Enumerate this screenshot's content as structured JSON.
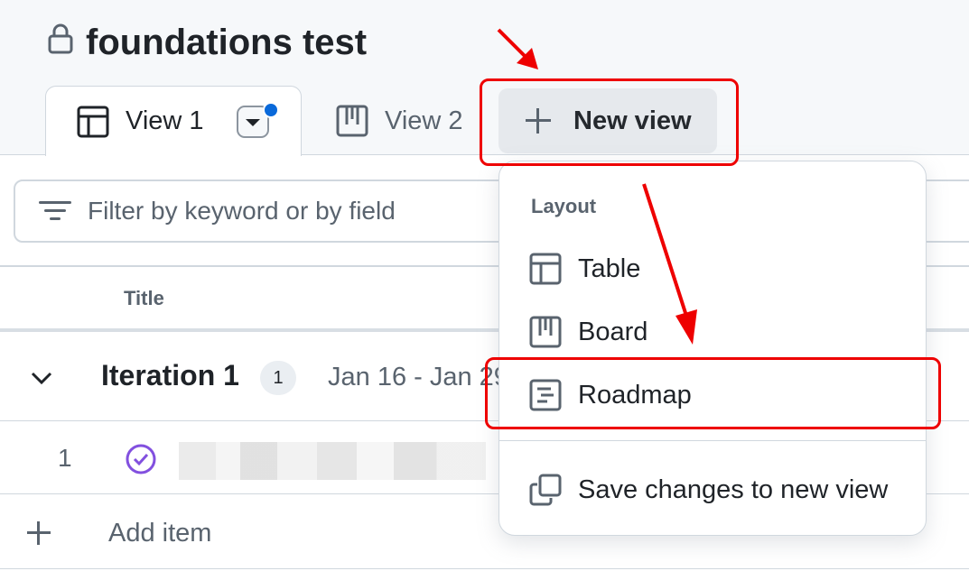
{
  "header": {
    "title": "foundations test",
    "lock_icon": "lock-icon"
  },
  "tabs": [
    {
      "label": "View 1",
      "icon": "table-icon",
      "active": true
    },
    {
      "label": "View 2",
      "icon": "board-icon",
      "active": false
    }
  ],
  "new_view_button": {
    "label": "New view",
    "icon": "plus-icon"
  },
  "filter": {
    "placeholder": "Filter by keyword or by field",
    "icon": "filter-icon"
  },
  "table": {
    "column_title": "Title",
    "group": {
      "title": "Iteration 1",
      "count": "1",
      "date_range": "Jan 16 - Jan 29"
    },
    "rows": [
      {
        "number": "1",
        "status_icon": "check-circle-icon"
      }
    ],
    "add_item_label": "Add item"
  },
  "menu": {
    "heading": "Layout",
    "items": [
      {
        "label": "Table",
        "icon": "table-icon"
      },
      {
        "label": "Board",
        "icon": "board-icon"
      },
      {
        "label": "Roadmap",
        "icon": "roadmap-icon"
      },
      {
        "label": "Save changes to new view",
        "icon": "copy-icon"
      }
    ]
  },
  "colors": {
    "accent_blue": "#0969da",
    "annotation_red": "#ee0000",
    "status_purple": "#8250df"
  }
}
